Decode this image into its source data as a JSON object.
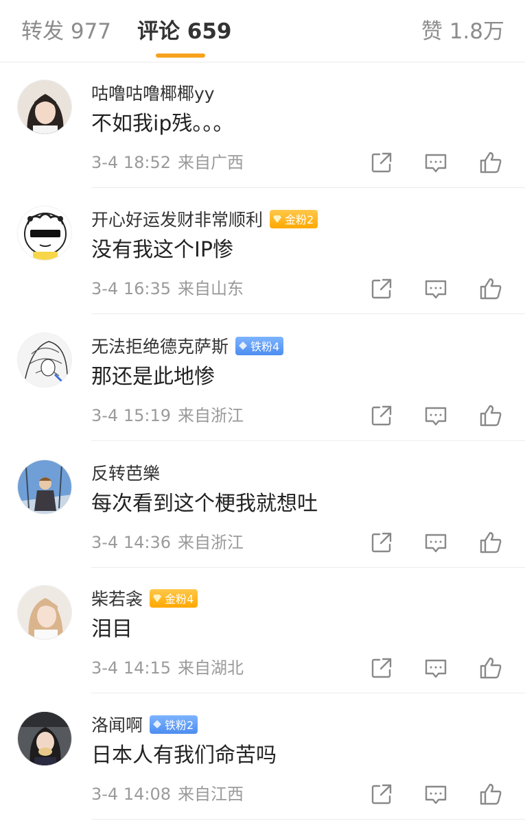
{
  "tabs": {
    "repost": "转发 977",
    "comment": "评论 659",
    "like": "赞 1.8万",
    "accent_color": "#f7a21b"
  },
  "comments": [
    {
      "username": "咕噜咕噜椰椰yy",
      "badge": "",
      "content": "不如我ip残。。。",
      "date": "3-4 18:52",
      "location": "来自广西"
    },
    {
      "username": "开心好运发财非常顺利",
      "badge": "金粉2",
      "content": "没有我这个IP惨",
      "date": "3-4 16:35",
      "location": "来自山东"
    },
    {
      "username": "无法拒绝德克萨斯",
      "badge": "铁粉4",
      "content": "那还是此地惨",
      "date": "3-4 15:19",
      "location": "来自浙江"
    },
    {
      "username": "反转芭樂",
      "badge": "",
      "content": "每次看到这个梗我就想吐",
      "date": "3-4 14:36",
      "location": "来自浙江"
    },
    {
      "username": "柴若衾",
      "badge": "金粉4",
      "content": "泪目",
      "date": "3-4 14:15",
      "location": "来自湖北"
    },
    {
      "username": "洛闻啊",
      "badge": "铁粉2",
      "content": "日本人有我们命苦吗",
      "date": "3-4 14:08",
      "location": "来自江西"
    }
  ],
  "badge_colors": {
    "gold": "#ffa800",
    "iron": "#4d8df0"
  },
  "action_icons": [
    "share-icon",
    "reply-icon",
    "like-icon"
  ]
}
